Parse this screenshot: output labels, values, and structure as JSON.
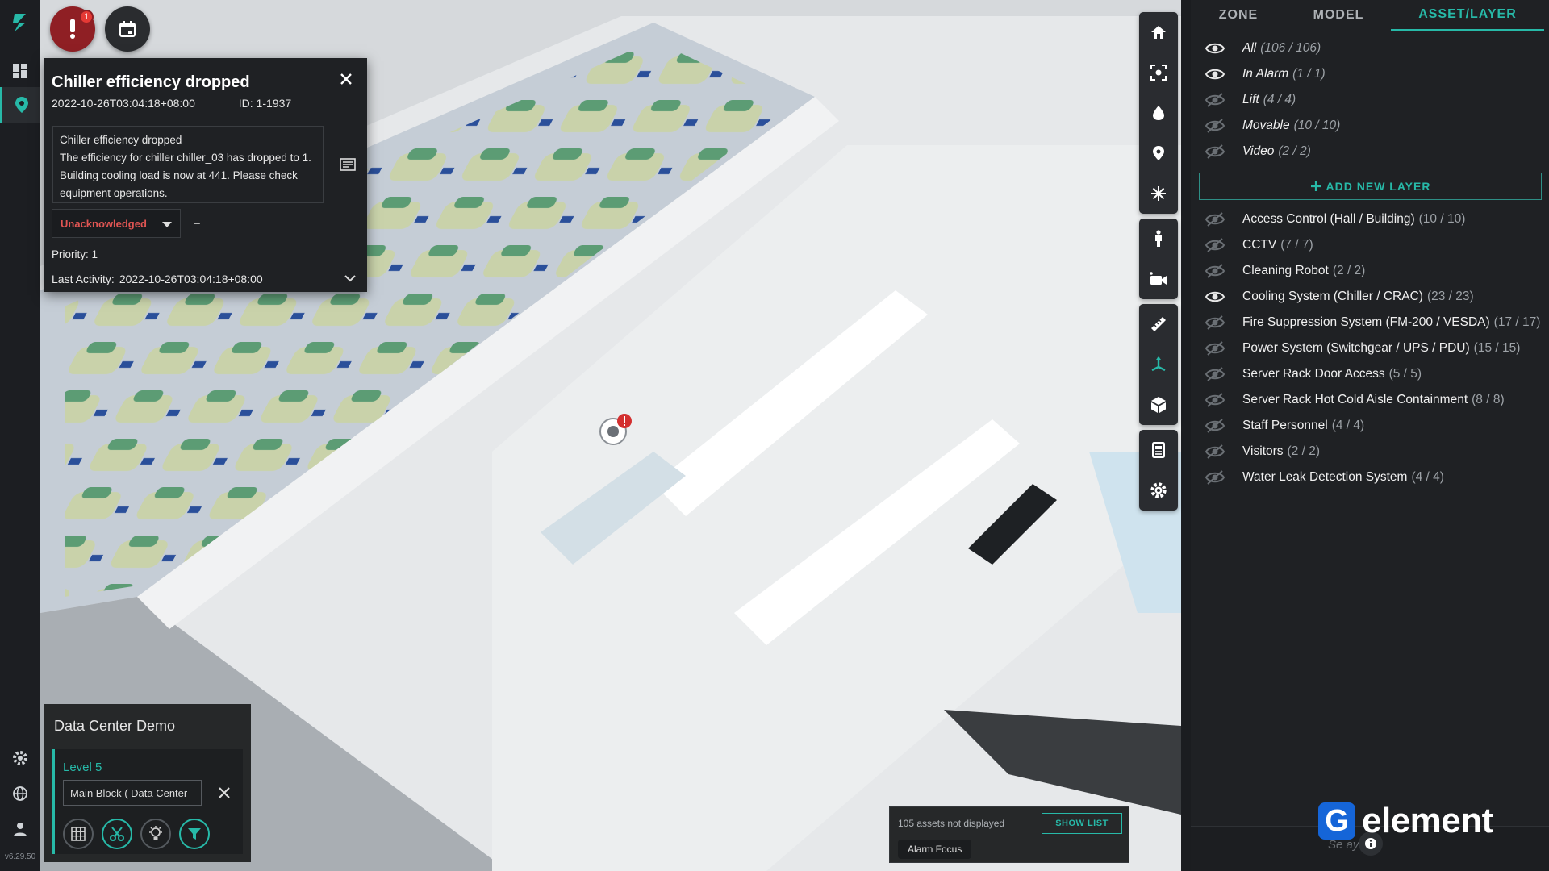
{
  "app": {
    "version": "v6.29.50",
    "accent": "#27b9a8"
  },
  "alarm_button": {
    "count": "1",
    "icon": "exclamation-icon"
  },
  "alarm_card": {
    "title": "Chiller efficiency dropped",
    "timestamp": "2022-10-26T03:04:18+08:00",
    "id_label": "ID: 1-1937",
    "description_title": "Chiller efficiency dropped",
    "description_body": "The efficiency for chiller chiller_03 has dropped to 1. Building cooling load is now at 441. Please check equipment operations.",
    "status": "Unacknowledged",
    "assignee": "–",
    "priority": "Priority: 1",
    "last_activity_label": "Last Activity:",
    "last_activity_value": "2022-10-26T03:04:18+08:00",
    "status_color": "#e05553"
  },
  "location": {
    "site": "Data Center Demo",
    "level": "Level 5",
    "path": "Main Block ( Data Center"
  },
  "toast": {
    "message": "105 assets not displayed",
    "button": "SHOW LIST",
    "chip": "Alarm Focus"
  },
  "right_panel": {
    "tabs": [
      {
        "label": "ZONE",
        "active": false
      },
      {
        "label": "MODEL",
        "active": false
      },
      {
        "label": "ASSET/LAYER",
        "active": true
      }
    ],
    "system_layers": [
      {
        "name": "All",
        "count": "(106 / 106)",
        "visible": true
      },
      {
        "name": "In Alarm",
        "count": "(1 / 1)",
        "visible": true
      },
      {
        "name": "Lift",
        "count": "(4 / 4)",
        "visible": false
      },
      {
        "name": "Movable",
        "count": "(10 / 10)",
        "visible": false
      },
      {
        "name": "Video",
        "count": "(2 / 2)",
        "visible": false
      }
    ],
    "add_layer_label": "ADD NEW LAYER",
    "layers": [
      {
        "name": "Access Control (Hall / Building)",
        "count": "(10 / 10)",
        "visible": false
      },
      {
        "name": "CCTV",
        "count": "(7 / 7)",
        "visible": false
      },
      {
        "name": "Cleaning Robot",
        "count": "(2 / 2)",
        "visible": false
      },
      {
        "name": "Cooling System (Chiller / CRAC)",
        "count": "(23 / 23)",
        "visible": true
      },
      {
        "name": "Fire Suppression System (FM-200 / VESDA)",
        "count": "(17 / 17)",
        "visible": false
      },
      {
        "name": "Power System (Switchgear / UPS / PDU)",
        "count": "(15 / 15)",
        "visible": false
      },
      {
        "name": "Server Rack Door Access",
        "count": "(5 / 5)",
        "visible": false
      },
      {
        "name": "Server Rack Hot Cold Aisle Containment",
        "count": "(8 / 8)",
        "visible": false
      },
      {
        "name": "Staff Personnel",
        "count": "(4 / 4)",
        "visible": false
      },
      {
        "name": "Visitors",
        "count": "(2 / 2)",
        "visible": false
      },
      {
        "name": "Water Leak Detection System",
        "count": "(4 / 4)",
        "visible": false
      }
    ],
    "footer_hint": "Se        ayer"
  },
  "brand": {
    "letter": "G",
    "word": "element",
    "color": "#1565d8"
  }
}
